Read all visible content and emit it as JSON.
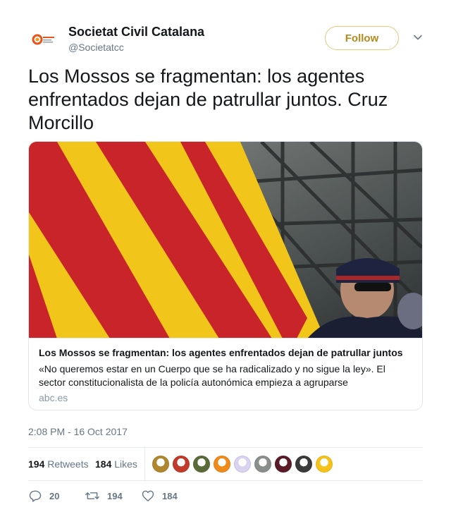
{
  "author": {
    "name": "Societat Civil Catalana",
    "handle": "@Societatcc"
  },
  "follow_label": "Follow",
  "tweet_text": "Los Mossos se fragmentan: los agentes enfrentados dejan de patrullar juntos. Cruz Morcillo",
  "card": {
    "title": "Los Mossos se fragmentan: los agentes enfrentados dejan de patrullar juntos",
    "description": "«No queremos estar en un Cuerpo que se ha radicalizado y no sigue la ley». El sector constitucionalista de la policía autonómica empieza a agruparse",
    "domain": "abc.es"
  },
  "timestamp": "2:08 PM - 16 Oct 2017",
  "stats": {
    "retweets_count": "194",
    "retweets_label": "Retweets",
    "likes_count": "184",
    "likes_label": "Likes"
  },
  "liker_avatar_colors": [
    "#b0862e",
    "#c23a2a",
    "#5a6b3a",
    "#f08a1a",
    "#d9d2f0",
    "#8a8f8c",
    "#5a1a26",
    "#3a3a3a",
    "#f4c21a"
  ],
  "actions": {
    "reply_count": "20",
    "retweet_count": "194",
    "like_count": "184"
  },
  "colors": {
    "follow_accent": "#b7881a",
    "muted_text": "#657786"
  }
}
